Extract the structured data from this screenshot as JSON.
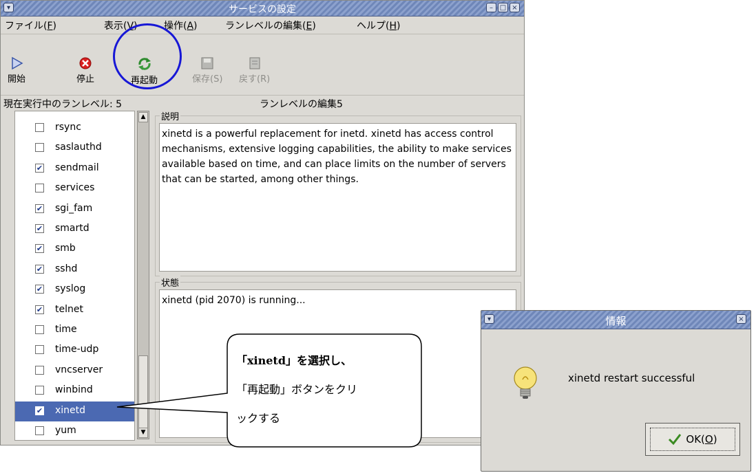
{
  "window": {
    "title": "サービスの設定",
    "menu": [
      {
        "pre": "ファイル(",
        "key": "F",
        "post": ")"
      },
      {
        "pre": "表示(",
        "key": "V",
        "post": ")"
      },
      {
        "pre": "操作(",
        "key": "A",
        "post": ")"
      },
      {
        "pre": "ランレベルの編集(",
        "key": "E",
        "post": ")"
      },
      {
        "pre": "ヘルプ(",
        "key": "H",
        "post": ")"
      }
    ],
    "toolbar": {
      "start": "開始",
      "stop": "停止",
      "restart": "再起動",
      "save": "保存(S)",
      "revert": "戻す(R)"
    },
    "current_runlevel": "現在実行中のランレベル: 5",
    "edit_runlevel": "ランレベルの編集5"
  },
  "services": [
    {
      "name": "rsync",
      "checked": false,
      "selected": false
    },
    {
      "name": "saslauthd",
      "checked": false,
      "selected": false
    },
    {
      "name": "sendmail",
      "checked": true,
      "selected": false
    },
    {
      "name": "services",
      "checked": false,
      "selected": false
    },
    {
      "name": "sgi_fam",
      "checked": true,
      "selected": false
    },
    {
      "name": "smartd",
      "checked": true,
      "selected": false
    },
    {
      "name": "smb",
      "checked": true,
      "selected": false
    },
    {
      "name": "sshd",
      "checked": true,
      "selected": false
    },
    {
      "name": "syslog",
      "checked": true,
      "selected": false
    },
    {
      "name": "telnet",
      "checked": true,
      "selected": false
    },
    {
      "name": "time",
      "checked": false,
      "selected": false
    },
    {
      "name": "time-udp",
      "checked": false,
      "selected": false
    },
    {
      "name": "vncserver",
      "checked": false,
      "selected": false
    },
    {
      "name": "winbind",
      "checked": false,
      "selected": false
    },
    {
      "name": "xinetd",
      "checked": true,
      "selected": true
    },
    {
      "name": "yum",
      "checked": false,
      "selected": false
    }
  ],
  "description": {
    "title": "説明",
    "text": "xinetd is a powerful replacement for inetd. xinetd has access control mechanisms, extensive logging capabilities, the ability to make services available based on time, and can place limits on the number of servers that can be started, among other things."
  },
  "status": {
    "title": "状態",
    "text": "xinetd (pid 2070) is running..."
  },
  "callout": {
    "line1": "「xinetd」を選択し、",
    "line2": "「再起動」ボタンをクリ",
    "line3": "ックする"
  },
  "dialog": {
    "title": "情報",
    "message": "xinetd restart successful",
    "ok_pre": "OK(",
    "ok_key": "O",
    "ok_post": ")"
  },
  "colors": {
    "selection": "#4b69b2",
    "titlebar": "#7a8fc0",
    "annotation_circle": "#1717d6"
  }
}
